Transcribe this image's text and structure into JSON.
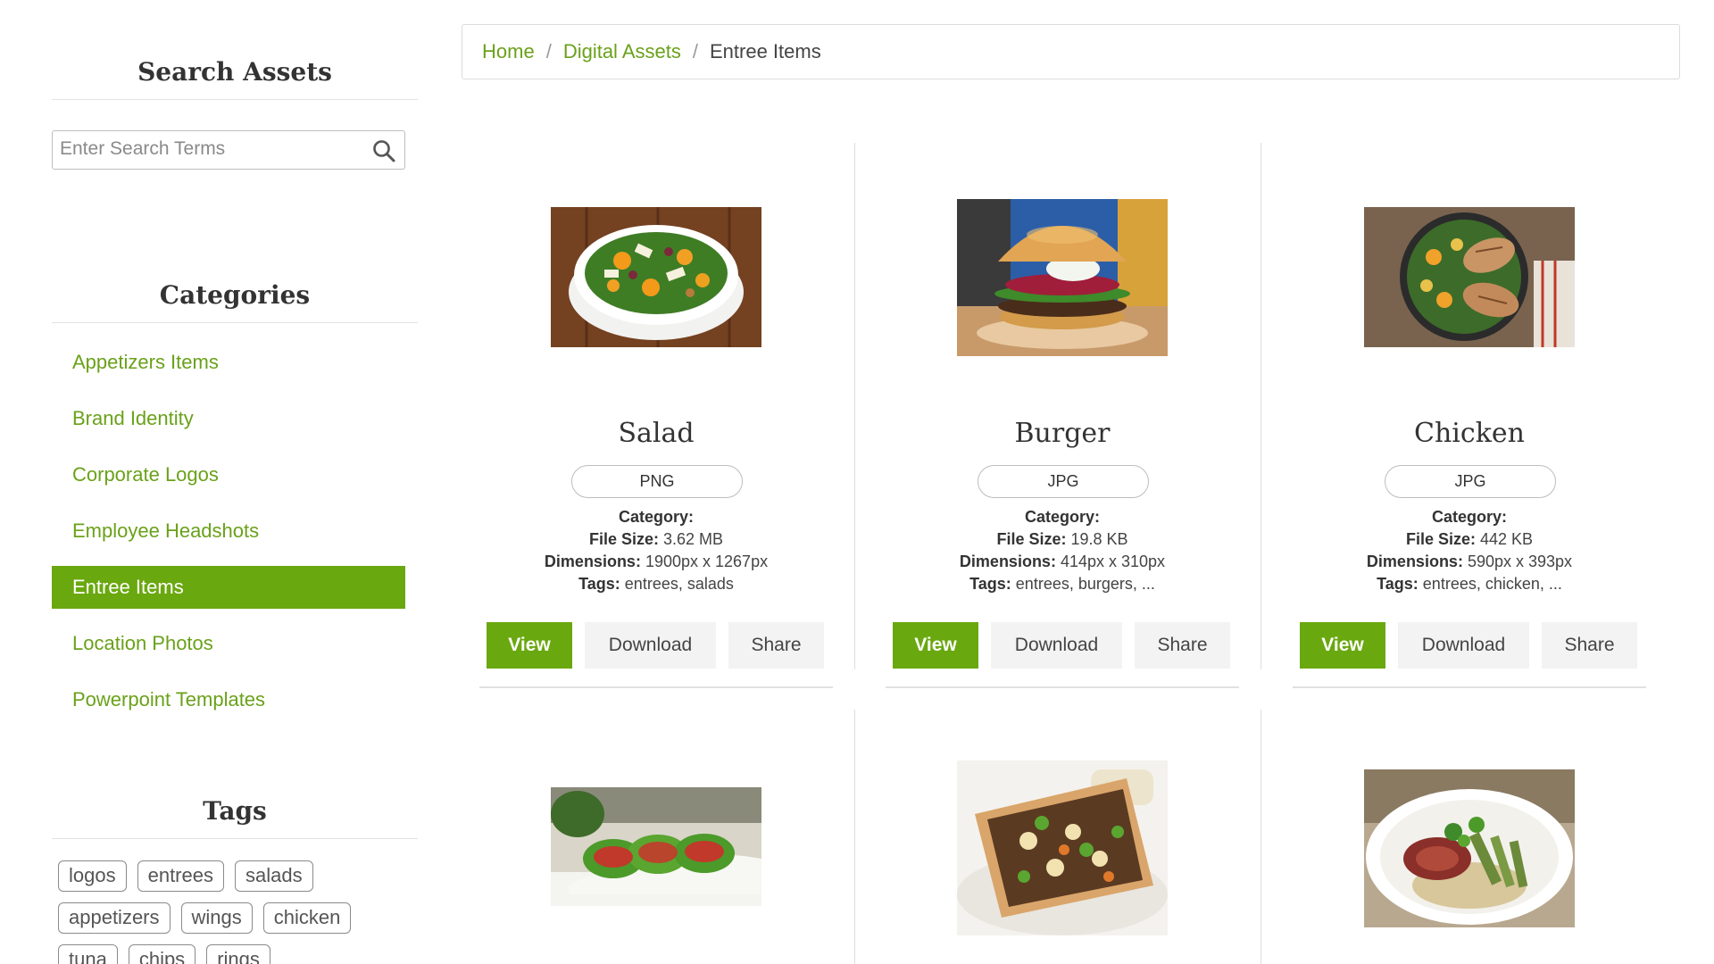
{
  "sidebar": {
    "search_heading": "Search Assets",
    "search_placeholder": "Enter Search Terms",
    "categories_heading": "Categories",
    "categories": [
      {
        "label": "Appetizers Items",
        "active": false
      },
      {
        "label": "Brand Identity",
        "active": false
      },
      {
        "label": "Corporate Logos",
        "active": false
      },
      {
        "label": "Employee Headshots",
        "active": false
      },
      {
        "label": "Entree Items",
        "active": true
      },
      {
        "label": "Location Photos",
        "active": false
      },
      {
        "label": "Powerpoint Templates",
        "active": false
      }
    ],
    "tags_heading": "Tags",
    "tags": [
      "logos",
      "entrees",
      "salads",
      "appetizers",
      "wings",
      "chicken",
      "tuna",
      "chips",
      "rings"
    ]
  },
  "breadcrumb": {
    "items": [
      "Home",
      "Digital Assets"
    ],
    "separator": "/",
    "current": "Entree Items"
  },
  "labels": {
    "category": "Category:",
    "file_size": "File Size:",
    "dimensions": "Dimensions:",
    "tags": "Tags:",
    "view": "View",
    "download": "Download",
    "share": "Share"
  },
  "assets": [
    {
      "title": "Salad",
      "format": "PNG",
      "category": "",
      "file_size": "3.62 MB",
      "dimensions": "1900px x 1267px",
      "tags": "entrees, salads"
    },
    {
      "title": "Burger",
      "format": "JPG",
      "category": "",
      "file_size": "19.8 KB",
      "dimensions": "414px x 310px",
      "tags": "entrees, burgers, ..."
    },
    {
      "title": "Chicken",
      "format": "JPG",
      "category": "",
      "file_size": "442 KB",
      "dimensions": "590px x 393px",
      "tags": "entrees, chicken, ..."
    }
  ],
  "colors": {
    "accent": "#6aa80f",
    "link": "#6aa11a"
  }
}
